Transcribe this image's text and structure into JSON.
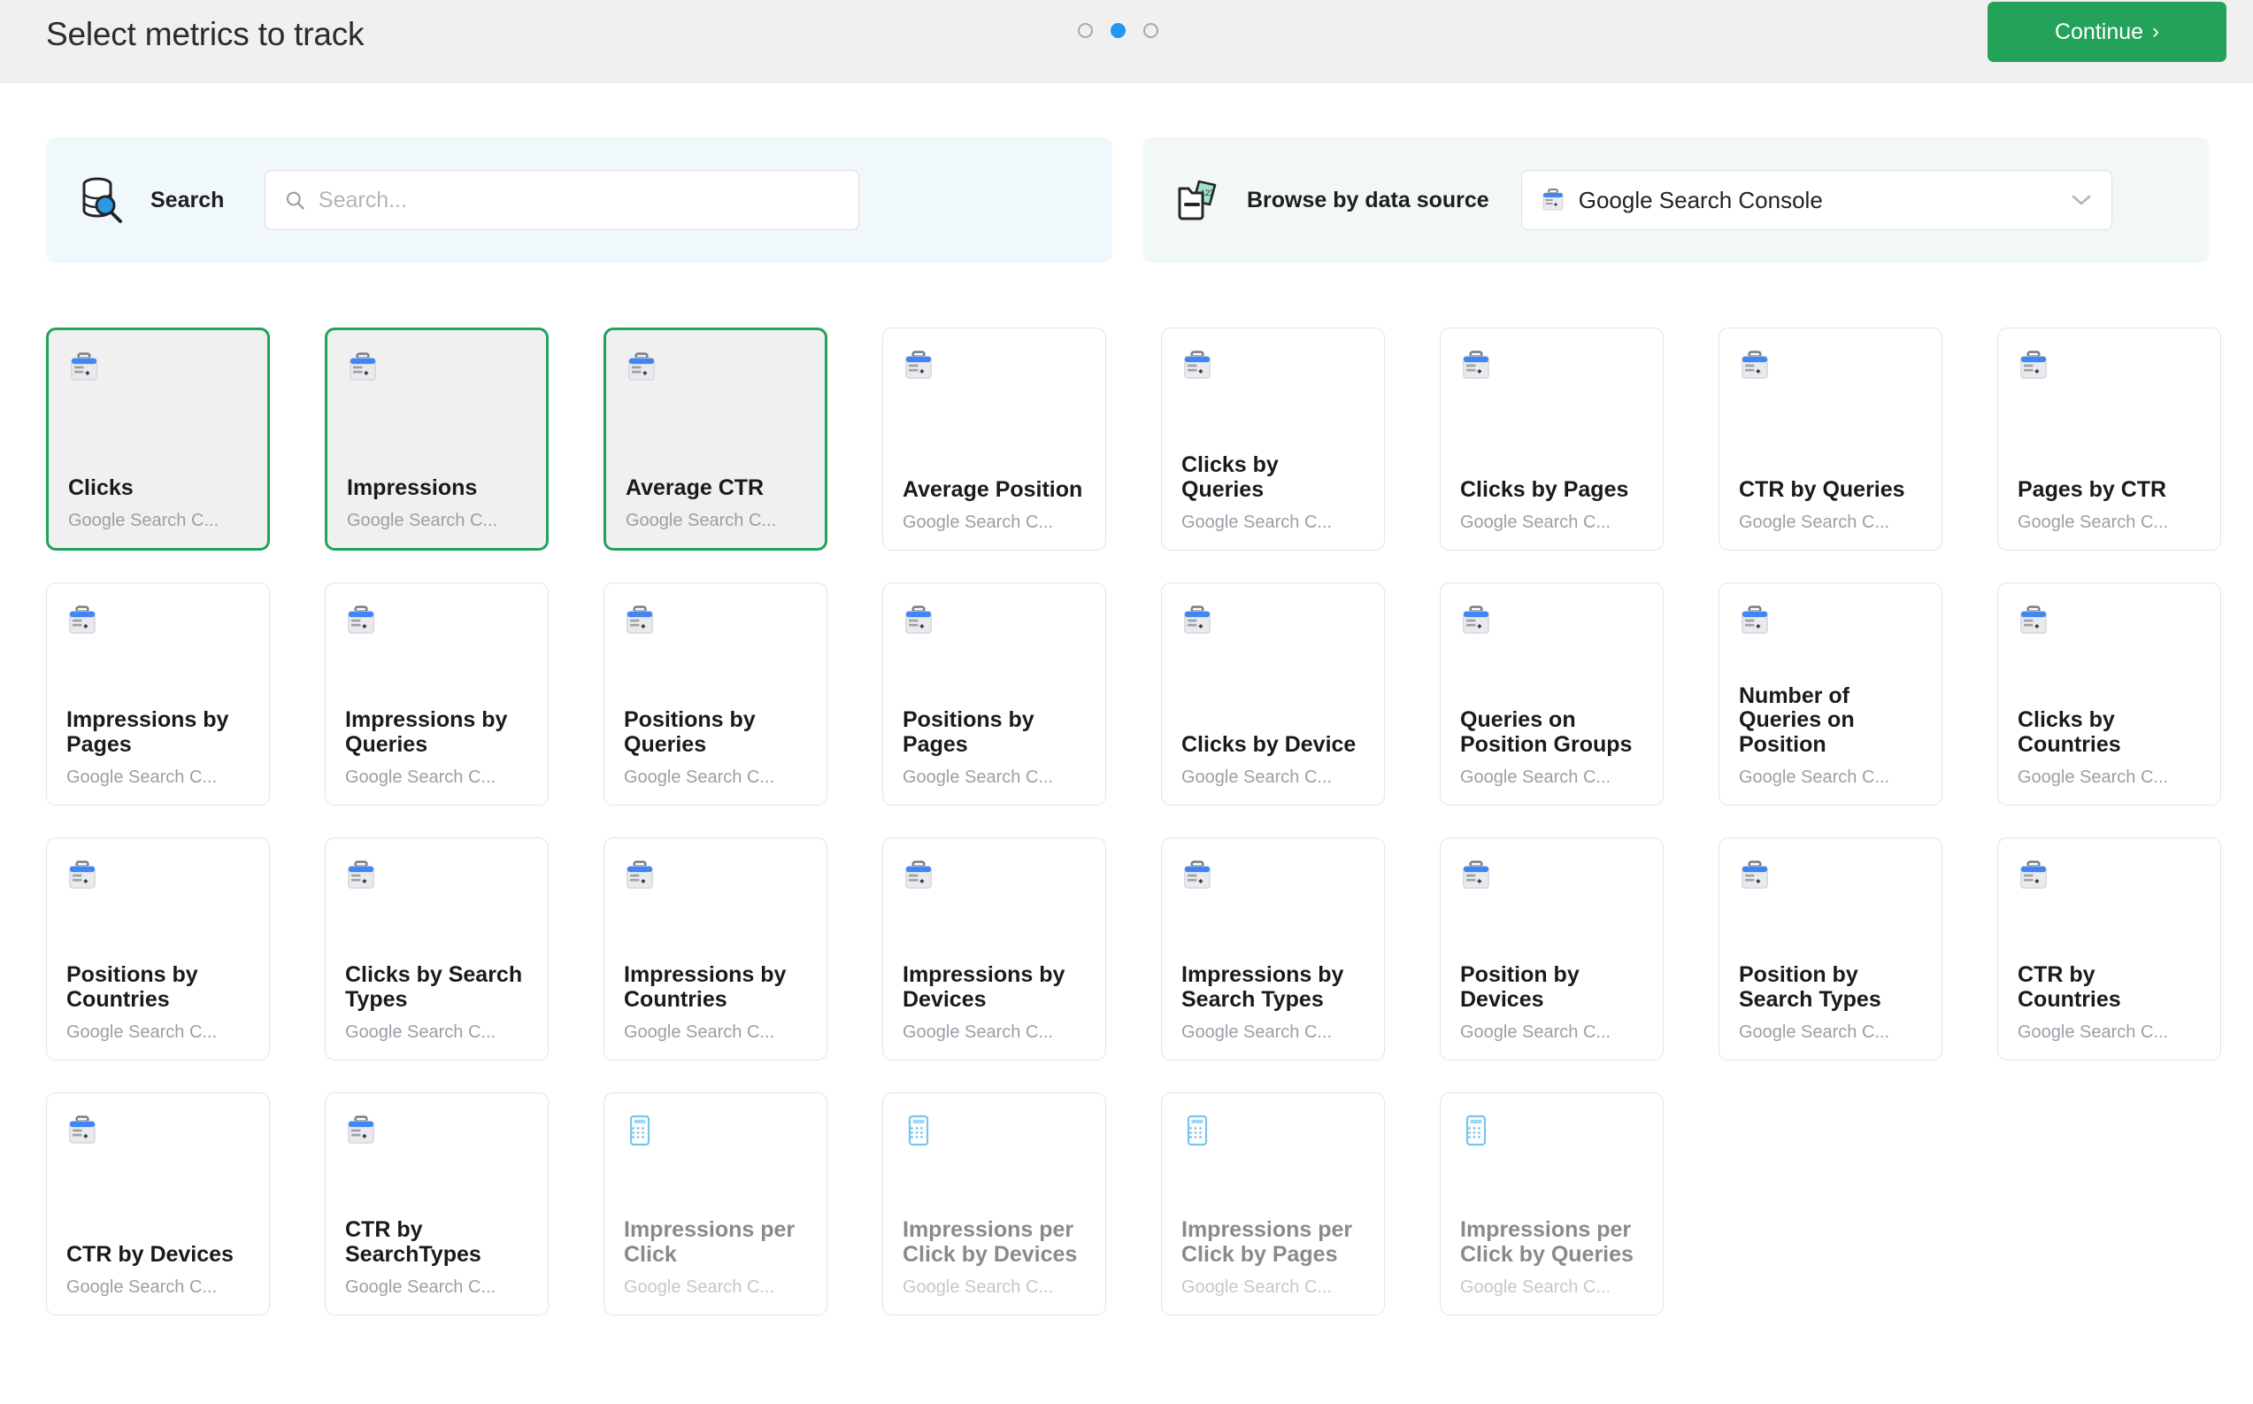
{
  "header": {
    "title": "Select metrics to track",
    "continue_label": "Continue",
    "continue_chevron": "›",
    "steps": [
      {
        "active": false
      },
      {
        "active": true
      },
      {
        "active": false
      }
    ],
    "accent_green": "#23a25a",
    "accent_blue": "#2196f3"
  },
  "search_panel": {
    "icon": "database-search-icon",
    "label": "Search",
    "input_value": "",
    "placeholder": "Search..."
  },
  "source_panel": {
    "icon": "data-source-icon",
    "label": "Browse by data source",
    "selected": "Google Search Console",
    "select_icon": "google-search-console-icon",
    "chevron": "chevron-down-icon"
  },
  "metrics": [
    {
      "title": "Clicks",
      "source": "Google Search C...",
      "icon": "gsc-icon",
      "selected": true,
      "disabled": false
    },
    {
      "title": "Impressions",
      "source": "Google Search C...",
      "icon": "gsc-icon",
      "selected": true,
      "disabled": false
    },
    {
      "title": "Average CTR",
      "source": "Google Search C...",
      "icon": "gsc-icon",
      "selected": true,
      "disabled": false
    },
    {
      "title": "Average Position",
      "source": "Google Search C...",
      "icon": "gsc-icon",
      "selected": false,
      "disabled": false
    },
    {
      "title": "Clicks by Queries",
      "source": "Google Search C...",
      "icon": "gsc-icon",
      "selected": false,
      "disabled": false
    },
    {
      "title": "Clicks by Pages",
      "source": "Google Search C...",
      "icon": "gsc-icon",
      "selected": false,
      "disabled": false
    },
    {
      "title": "CTR by Queries",
      "source": "Google Search C...",
      "icon": "gsc-icon",
      "selected": false,
      "disabled": false
    },
    {
      "title": "Pages by CTR",
      "source": "Google Search C...",
      "icon": "gsc-icon",
      "selected": false,
      "disabled": false
    },
    {
      "title": "Impressions by Pages",
      "source": "Google Search C...",
      "icon": "gsc-icon",
      "selected": false,
      "disabled": false
    },
    {
      "title": "Impressions by Queries",
      "source": "Google Search C...",
      "icon": "gsc-icon",
      "selected": false,
      "disabled": false
    },
    {
      "title": "Positions by Queries",
      "source": "Google Search C...",
      "icon": "gsc-icon",
      "selected": false,
      "disabled": false
    },
    {
      "title": "Positions by Pages",
      "source": "Google Search C...",
      "icon": "gsc-icon",
      "selected": false,
      "disabled": false
    },
    {
      "title": "Clicks by Device",
      "source": "Google Search C...",
      "icon": "gsc-icon",
      "selected": false,
      "disabled": false
    },
    {
      "title": "Queries on Position Groups",
      "source": "Google Search C...",
      "icon": "gsc-icon",
      "selected": false,
      "disabled": false
    },
    {
      "title": "Number of Queries on Position",
      "source": "Google Search C...",
      "icon": "gsc-icon",
      "selected": false,
      "disabled": false
    },
    {
      "title": "Clicks by Countries",
      "source": "Google Search C...",
      "icon": "gsc-icon",
      "selected": false,
      "disabled": false
    },
    {
      "title": "Positions by Countries",
      "source": "Google Search C...",
      "icon": "gsc-icon",
      "selected": false,
      "disabled": false
    },
    {
      "title": "Clicks by Search Types",
      "source": "Google Search C...",
      "icon": "gsc-icon",
      "selected": false,
      "disabled": false
    },
    {
      "title": "Impressions by Countries",
      "source": "Google Search C...",
      "icon": "gsc-icon",
      "selected": false,
      "disabled": false
    },
    {
      "title": "Impressions by Devices",
      "source": "Google Search C...",
      "icon": "gsc-icon",
      "selected": false,
      "disabled": false
    },
    {
      "title": "Impressions by Search Types",
      "source": "Google Search C...",
      "icon": "gsc-icon",
      "selected": false,
      "disabled": false
    },
    {
      "title": "Position by Devices",
      "source": "Google Search C...",
      "icon": "gsc-icon",
      "selected": false,
      "disabled": false
    },
    {
      "title": "Position by Search Types",
      "source": "Google Search C...",
      "icon": "gsc-icon",
      "selected": false,
      "disabled": false
    },
    {
      "title": "CTR by Countries",
      "source": "Google Search C...",
      "icon": "gsc-icon",
      "selected": false,
      "disabled": false
    },
    {
      "title": "CTR by Devices",
      "source": "Google Search C...",
      "icon": "gsc-icon",
      "selected": false,
      "disabled": false
    },
    {
      "title": "CTR by SearchTypes",
      "source": "Google Search C...",
      "icon": "gsc-icon",
      "selected": false,
      "disabled": false
    },
    {
      "title": "Impressions per Click",
      "source": "Google Search C...",
      "icon": "calculator-icon",
      "selected": false,
      "disabled": true
    },
    {
      "title": "Impressions per Click by Devices",
      "source": "Google Search C...",
      "icon": "calculator-icon",
      "selected": false,
      "disabled": true
    },
    {
      "title": "Impressions per Click by Pages",
      "source": "Google Search C...",
      "icon": "calculator-icon",
      "selected": false,
      "disabled": true
    },
    {
      "title": "Impressions per Click by Queries",
      "source": "Google Search C...",
      "icon": "calculator-icon",
      "selected": false,
      "disabled": true
    }
  ]
}
